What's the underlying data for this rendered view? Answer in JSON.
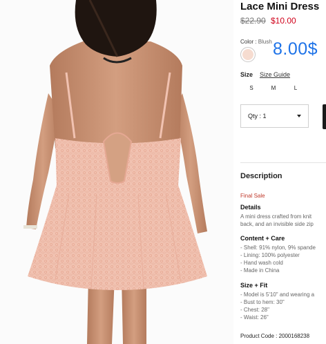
{
  "product": {
    "title": "Lace Mini Dress",
    "price_original": "$22.90",
    "price_sale": "$10.00",
    "overlay_price": "8.00$"
  },
  "color": {
    "label": "Color :",
    "value": "Blush",
    "swatch_hex": "#f6dcd0"
  },
  "size": {
    "label": "Size",
    "guide_label": "Size Guide",
    "options": [
      "S",
      "M",
      "L"
    ]
  },
  "quantity": {
    "label": "Qty : 1"
  },
  "description": {
    "heading": "Description",
    "final_sale": "Final Sale",
    "details_heading": "Details",
    "details_lines": [
      "A mini dress crafted from knit",
      "back, and an invisible side zip"
    ],
    "content_heading": "Content + Care",
    "content_lines": [
      "- Shell: 91% nylon, 9% spande",
      "- Lining: 100% polyester",
      "- Hand wash cold",
      "- Made in China"
    ],
    "fit_heading": "Size + Fit",
    "fit_lines": [
      "- Model is 5'10\" and wearing a",
      "- Bust to hem: 30\"",
      "- Chest: 28\"",
      "- Waist: 26\""
    ],
    "product_code": "Product Code : 2000168238"
  },
  "colors": {
    "accent_red": "#d0021b",
    "overlay_blue": "#1e73e8",
    "dress": "#f2c3b3",
    "hair": "#1f1510",
    "skin": "#c98f6e"
  }
}
